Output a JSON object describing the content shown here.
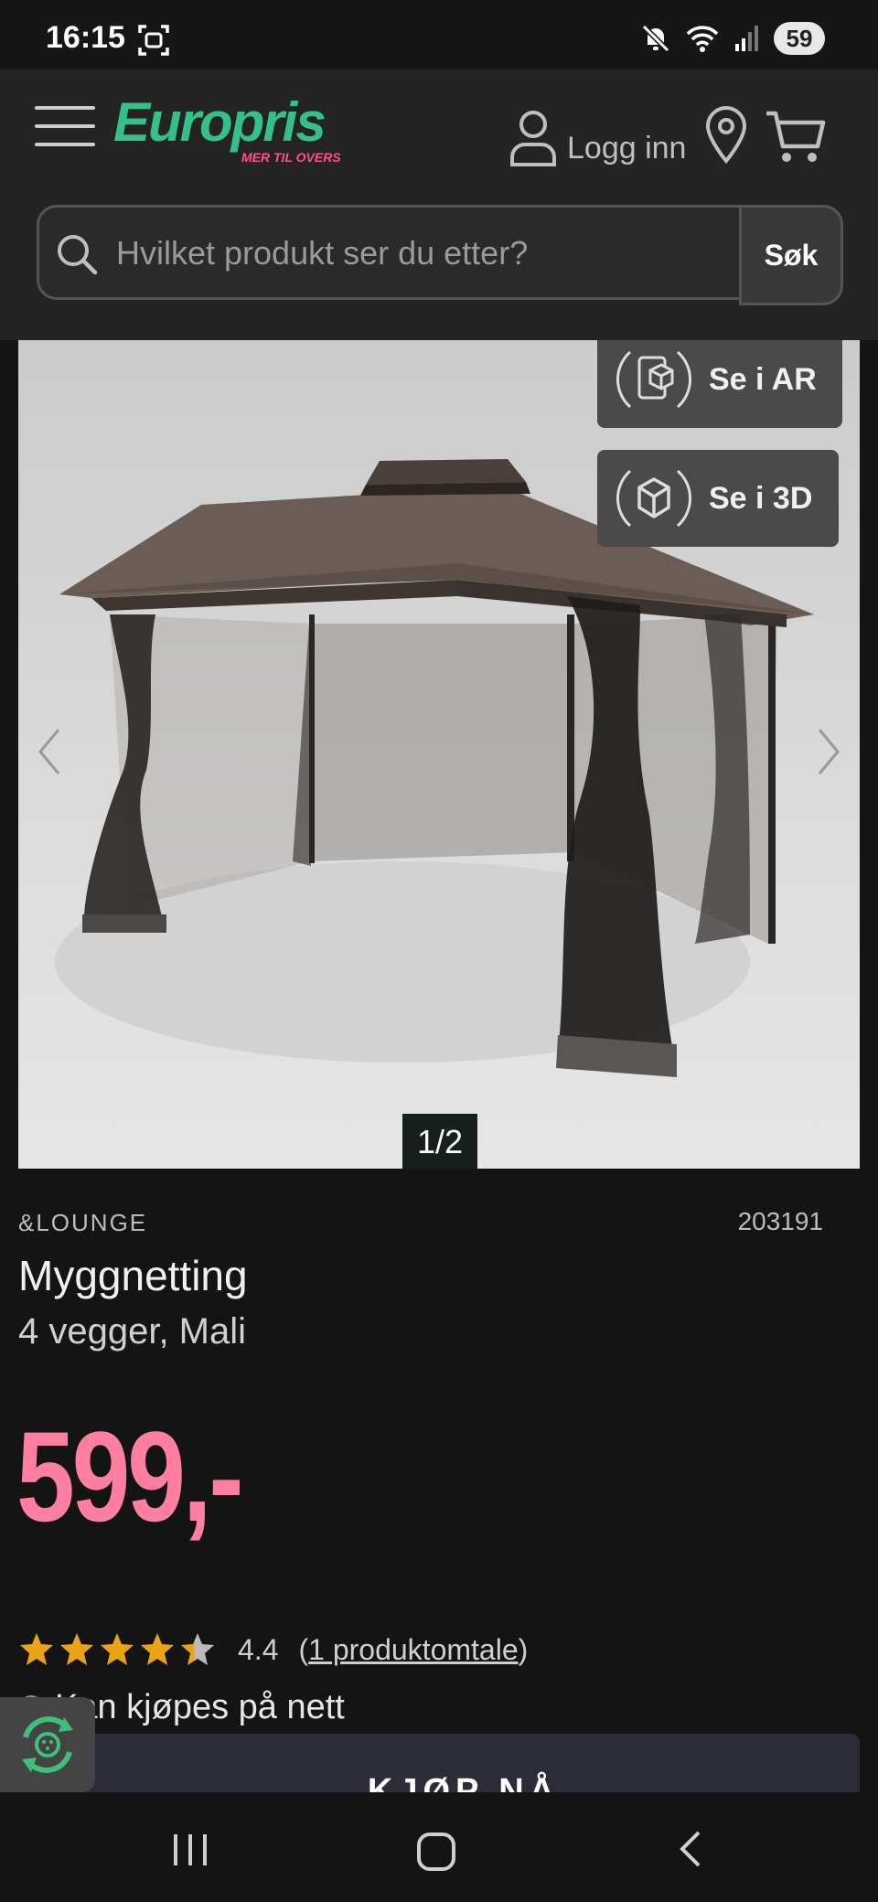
{
  "status_bar": {
    "time": "16:15",
    "battery": "59",
    "icons": [
      "screenshot-icon",
      "mute-icon",
      "wifi-icon",
      "signal-icon"
    ]
  },
  "header": {
    "logo": "Europris",
    "logo_tagline": "MER TIL OVERS",
    "login_label": "Logg inn",
    "search": {
      "placeholder": "Hvilket produkt ser du etter?",
      "button_label": "Søk"
    },
    "colors": {
      "logo_green": "#35c08a",
      "tagline_pink": "#ff4f8b"
    }
  },
  "gallery": {
    "ar_label": "Se i AR",
    "view3d_label": "Se i 3D",
    "counter": "1/2"
  },
  "product": {
    "brand": "&LOUNGE",
    "sku": "203191",
    "title": "Myggnetting",
    "subtitle": "4 vegger, Mali",
    "price": "599,-",
    "price_color": "#ff7fa3",
    "rating": {
      "value": "4.4",
      "stars": 4.4,
      "max_stars": 5,
      "review_prefix": "(",
      "review_link": "1 produktomtale",
      "review_suffix": ")"
    },
    "availability": "Kan kjøpes på nett",
    "buy_label": "KJØP NÅ"
  },
  "nav_bar": {
    "icons": [
      "recent-apps-icon",
      "home-icon",
      "back-icon"
    ]
  }
}
